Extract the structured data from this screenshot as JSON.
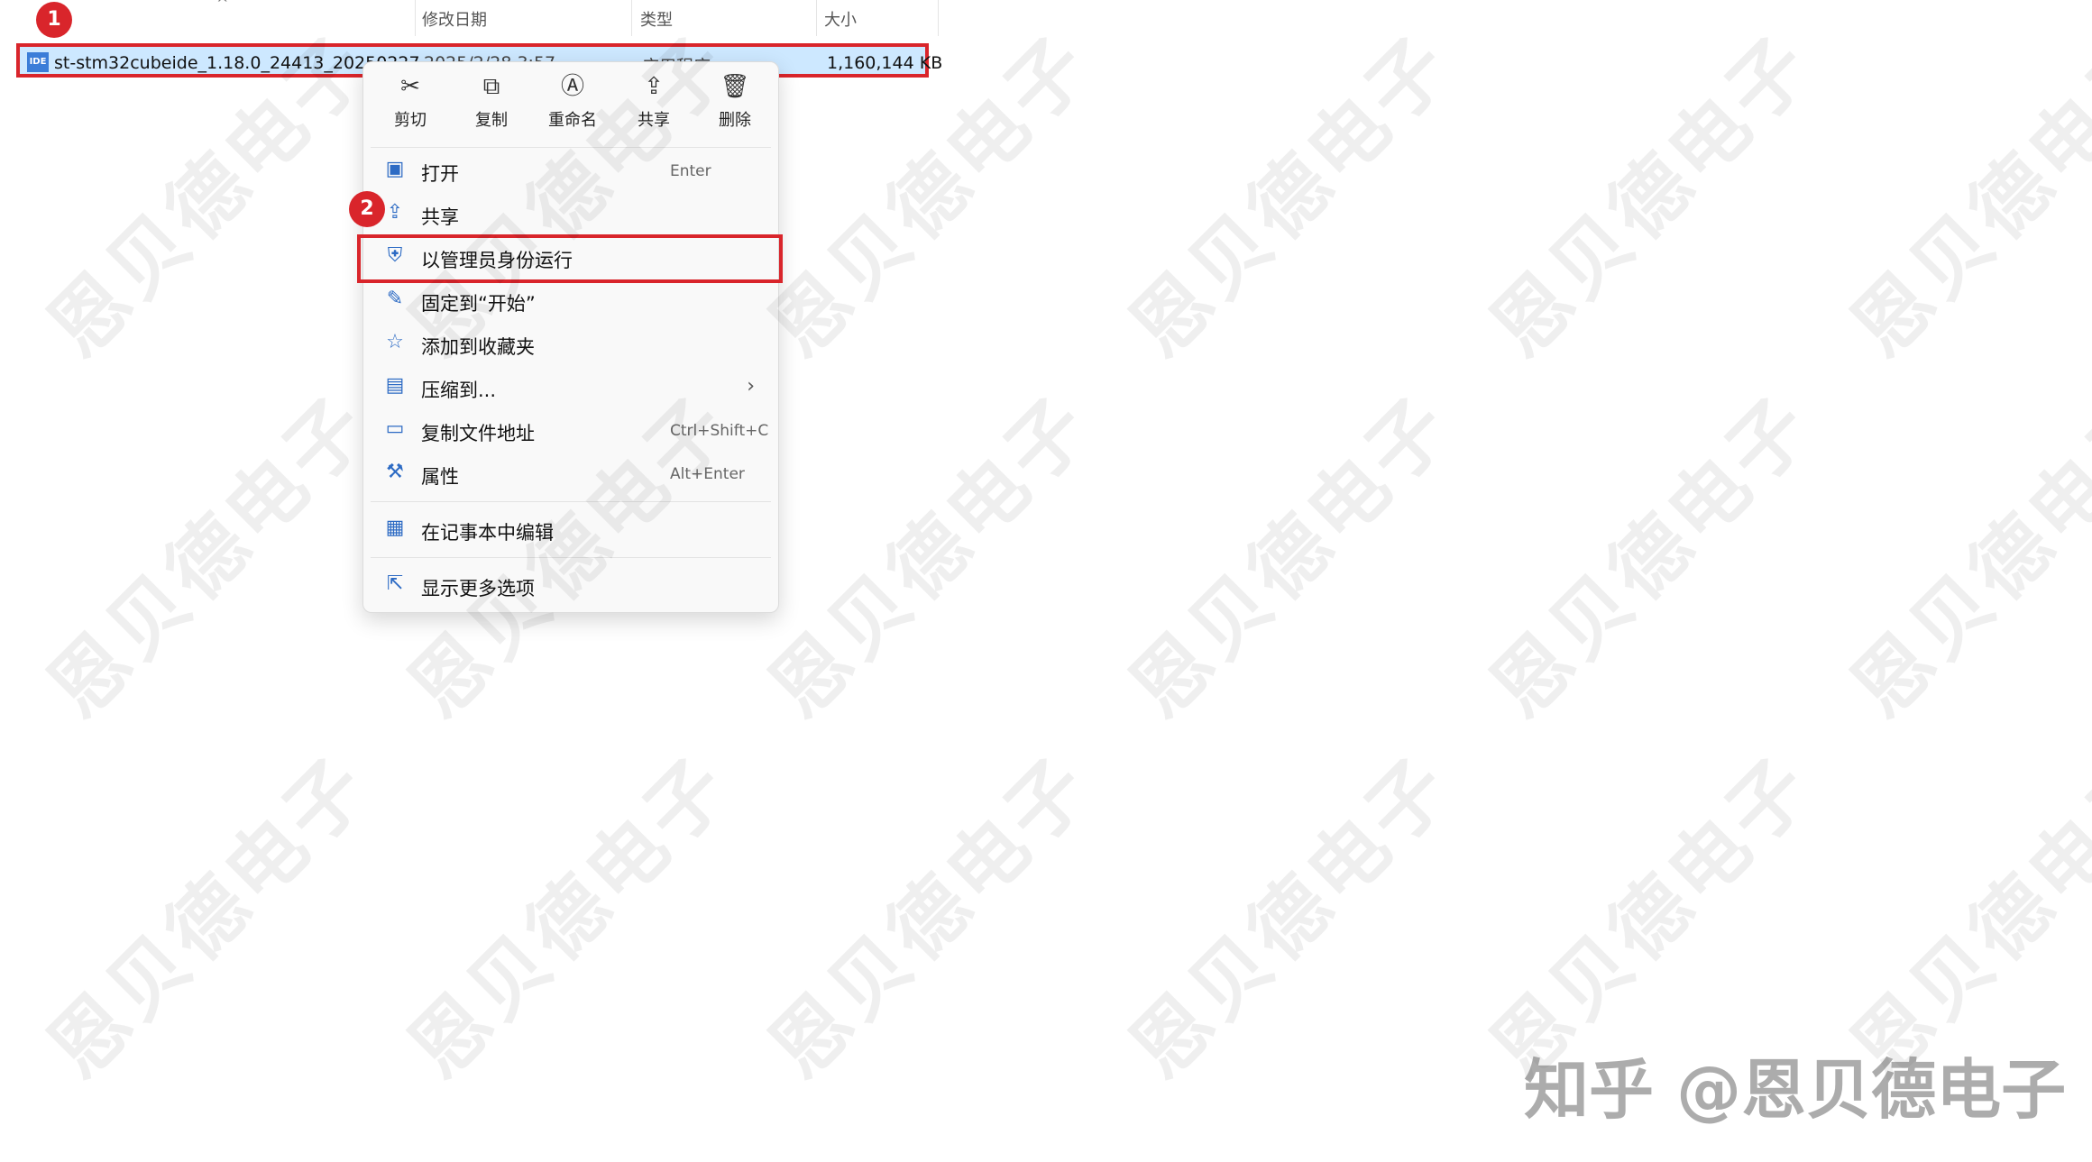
{
  "header": {
    "columns": [
      "修改日期",
      "类型",
      "大小"
    ]
  },
  "file": {
    "name": "st-stm32cubeide_1.18.0_24413_20250227",
    "date": "2025/2/28 3:57",
    "type": "应用程序",
    "size": "1,160,144 KB",
    "icon_label": "IDE"
  },
  "markers": [
    "1",
    "2"
  ],
  "toolbar": [
    {
      "label": "剪切",
      "icon": "scissors-icon",
      "glyph": "✂"
    },
    {
      "label": "复制",
      "icon": "copy-icon",
      "glyph": "⧉"
    },
    {
      "label": "重命名",
      "icon": "rename-icon",
      "glyph": "Ⓐ"
    },
    {
      "label": "共享",
      "icon": "share-icon",
      "glyph": "⇪"
    },
    {
      "label": "删除",
      "icon": "trash-icon",
      "glyph": "🗑"
    }
  ],
  "menu": {
    "items": [
      {
        "label": "打开",
        "shortcut": "Enter",
        "icon": "window-icon",
        "glyph": "▣"
      },
      {
        "label": "共享",
        "shortcut": "",
        "icon": "share-icon",
        "glyph": "⇪"
      },
      {
        "label": "以管理员身份运行",
        "shortcut": "",
        "icon": "shield-icon",
        "glyph": "⛨"
      },
      {
        "label": "固定到“开始”",
        "shortcut": "",
        "icon": "pin-icon",
        "glyph": "✎"
      },
      {
        "label": "添加到收藏夹",
        "shortcut": "",
        "icon": "star-icon",
        "glyph": "☆"
      },
      {
        "label": "压缩到...",
        "shortcut": "",
        "icon": "archive-icon",
        "glyph": "▤",
        "submenu": "›"
      },
      {
        "label": "复制文件地址",
        "shortcut": "Ctrl+Shift+C",
        "icon": "path-icon",
        "glyph": "▭"
      },
      {
        "label": "属性",
        "shortcut": "Alt+Enter",
        "icon": "wrench-icon",
        "glyph": "⚒"
      },
      {
        "label": "在记事本中编辑",
        "shortcut": "",
        "icon": "notepad-icon",
        "glyph": "▦"
      },
      {
        "label": "显示更多选项",
        "shortcut": "",
        "icon": "more-options-icon",
        "glyph": "⇱"
      }
    ]
  },
  "watermark": {
    "text": "恩贝德电子",
    "brand": "知乎 @恩贝德电子"
  },
  "colors": {
    "highlight_red": "#d9252b",
    "selection_blue": "#cde8ff",
    "accent": "#2d6bc4"
  }
}
